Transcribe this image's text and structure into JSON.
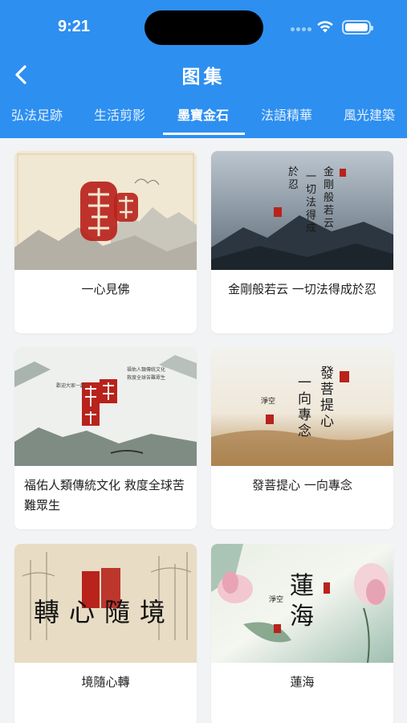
{
  "status_bar": {
    "time": "9:21"
  },
  "header": {
    "title": "图集"
  },
  "tabs": [
    {
      "label": "弘法足跡"
    },
    {
      "label": "生活剪影"
    },
    {
      "label": "墨寶金石"
    },
    {
      "label": "法語精華"
    },
    {
      "label": "風光建築"
    }
  ],
  "active_tab": "墨寶金石",
  "cards": [
    {
      "caption": "一心見佛",
      "seal_text": "一心見佛"
    },
    {
      "caption": "金剛般若云 一切法得成於忍",
      "calligraphy": "金剛般若云 一切法得成於忍"
    },
    {
      "caption": "福佑人類傳統文化 救度全球苦難眾生",
      "seal_text": "福佑人類"
    },
    {
      "caption": "發菩提心 一向專念",
      "calligraphy": "發菩提心 一向專念"
    },
    {
      "caption": "境隨心轉",
      "calligraphy": "轉心隨境"
    },
    {
      "caption": "蓮海",
      "calligraphy": "蓮海"
    }
  ],
  "colors": {
    "header_bg": "#2d8ff0",
    "page_bg": "#f2f3f5",
    "seal_red": "#b8231c"
  }
}
